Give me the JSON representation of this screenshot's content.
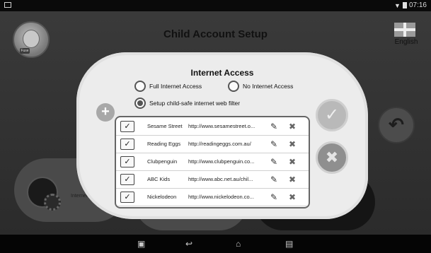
{
  "status_bar": {
    "time": "07:16",
    "wifi_icon": "wifi-icon",
    "battery_icon": "battery-icon"
  },
  "header": {
    "title": "Child Account Setup",
    "language": "English",
    "avatar_tag": "Fuse"
  },
  "background": {
    "internet_label": "Internet"
  },
  "dialog": {
    "title": "Internet Access",
    "options": {
      "full": "Full Internet Access",
      "none": "No Internet Access",
      "filter": "Setup child-safe internet web filter"
    },
    "selected_option": "filter",
    "sites": [
      {
        "name": "Sesame Street",
        "url": "http://www.sesamestreet.o...",
        "checked": true
      },
      {
        "name": "Reading Eggs",
        "url": "http://readingeggs.com.au/",
        "checked": true
      },
      {
        "name": "Clubpenguin",
        "url": "http://www.clubpenguin.co...",
        "checked": true
      },
      {
        "name": "ABC Kids",
        "url": "http://www.abc.net.au/chil...",
        "checked": true
      },
      {
        "name": "Nickelodeon",
        "url": "http://www.nickelodeon.co...",
        "checked": true
      }
    ]
  },
  "colors": {
    "dialog_bg": "#ececec",
    "dim_bg": "#333333"
  }
}
